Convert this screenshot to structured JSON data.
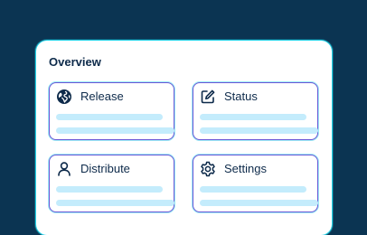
{
  "overview": {
    "title": "Overview",
    "cards": [
      {
        "label": "Release",
        "icon": "globe-icon"
      },
      {
        "label": "Status",
        "icon": "edit-icon"
      },
      {
        "label": "Distribute",
        "icon": "user-icon"
      },
      {
        "label": "Settings",
        "icon": "gear-icon"
      }
    ]
  },
  "colors": {
    "background": "#0b3452",
    "panel": "#ffffff",
    "card_border": "#6c57d6",
    "accent_glow": "#25d3e8",
    "placeholder_bar": "#c4ecfc",
    "text": "#0d2a4a"
  }
}
